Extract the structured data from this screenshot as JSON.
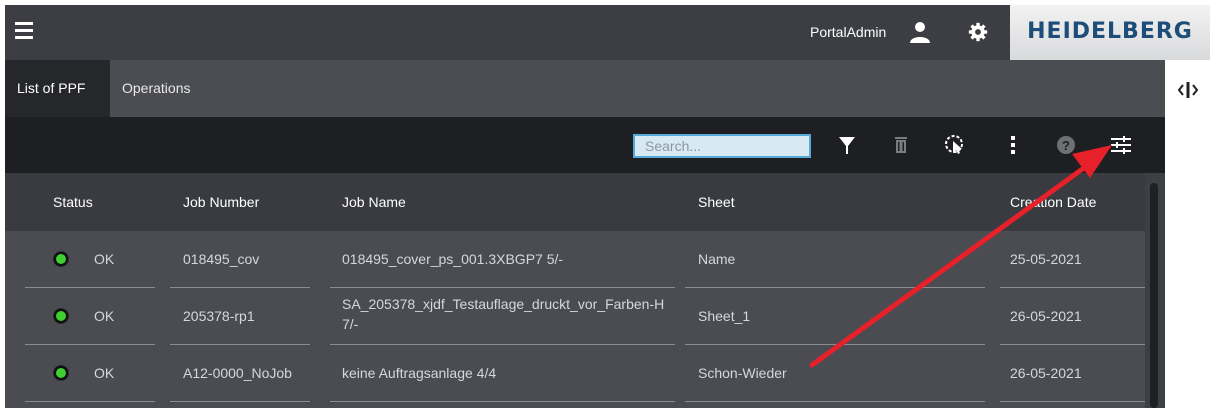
{
  "header": {
    "user_name": "PortalAdmin",
    "brand": "HEIDELBERG",
    "icons": [
      "menu-icon",
      "user-icon",
      "gear-icon"
    ]
  },
  "tabs": [
    {
      "label": "List of PPF",
      "active": true
    },
    {
      "label": "Operations",
      "active": false
    }
  ],
  "toolbar": {
    "search_placeholder": "Search...",
    "icons": [
      "filter-icon",
      "trash-icon",
      "select-icon",
      "more-vertical-icon",
      "help-icon",
      "column-settings-icon"
    ]
  },
  "table": {
    "columns": [
      "Status",
      "Job Number",
      "Job Name",
      "Sheet",
      "Creation Date"
    ],
    "rows": [
      {
        "status": "OK",
        "job_number": "018495_cov",
        "job_name": "018495_cover_ps_001.3XBGP7 5/-",
        "sheet": "Name",
        "creation_date": "25-05-2021"
      },
      {
        "status": "OK",
        "job_number": "205378-rp1",
        "job_name": "SA_205378_xjdf_Testauflage_druckt_vor_Farben-H 7/-",
        "sheet": "Sheet_1",
        "creation_date": "26-05-2021"
      },
      {
        "status": "OK",
        "job_number": "A12-0000_NoJob",
        "job_name": "keine Auftragsanlage 4/4",
        "sheet": "Schon-Wieder",
        "creation_date": "26-05-2021"
      }
    ]
  },
  "colors": {
    "status_ok": "#3fcf2f",
    "search_border": "#57a9d8",
    "brand_blue": "#1f4d7a",
    "annotation_arrow": "#e8202a"
  }
}
